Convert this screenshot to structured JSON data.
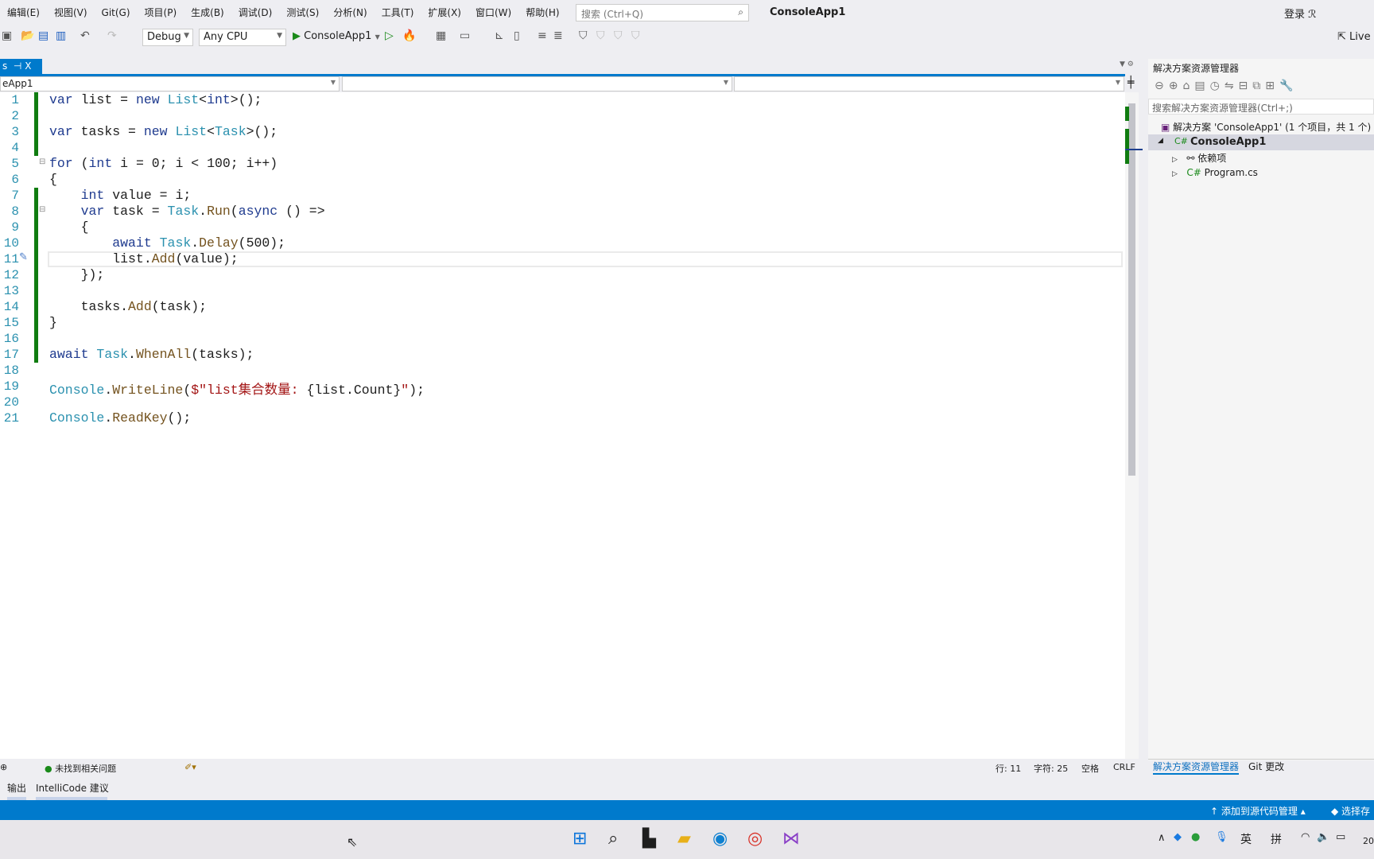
{
  "menu": [
    "编辑(E)",
    "视图(V)",
    "Git(G)",
    "项目(P)",
    "生成(B)",
    "调试(D)",
    "测试(S)",
    "分析(N)",
    "工具(T)",
    "扩展(X)",
    "窗口(W)",
    "帮助(H)"
  ],
  "search_placeholder": "搜索 (Ctrl+Q)",
  "window_title": "ConsoleApp1",
  "login": "登录",
  "toolbar": {
    "config": "Debug",
    "platform": "Any CPU",
    "run_target": "ConsoleApp1",
    "live_share": "Live"
  },
  "tab": {
    "label": "s",
    "pin": "⊣",
    "close": "X"
  },
  "nav": {
    "project": "eApp1"
  },
  "code": {
    "lines": [
      [
        [
          "var",
          "kw"
        ],
        " list = ",
        [
          "new",
          "kw"
        ],
        " ",
        [
          "List",
          "ty"
        ],
        "<",
        [
          "int",
          "kw"
        ],
        ">();"
      ],
      [],
      [
        [
          "var",
          "kw"
        ],
        " tasks = ",
        [
          "new",
          "kw"
        ],
        " ",
        [
          "List",
          "ty"
        ],
        "<",
        [
          "Task",
          "ty"
        ],
        ">();"
      ],
      [],
      [
        [
          "for",
          "kw"
        ],
        " (",
        [
          "int",
          "kw"
        ],
        " i = 0; i < 100; i++)"
      ],
      [
        "{"
      ],
      [
        "    ",
        [
          "int",
          "kw"
        ],
        " value = i;"
      ],
      [
        "    ",
        [
          "var",
          "kw"
        ],
        " task = ",
        [
          "Task",
          "ty"
        ],
        ".",
        [
          "Run",
          "me"
        ],
        "(",
        [
          "async",
          "kw"
        ],
        " () =>"
      ],
      [
        "    {"
      ],
      [
        "        ",
        [
          "await",
          "kw"
        ],
        " ",
        [
          "Task",
          "ty"
        ],
        ".",
        [
          "Delay",
          "me"
        ],
        "(500);"
      ],
      [
        "        list.",
        [
          "Add",
          "me"
        ],
        "(value);"
      ],
      [
        "    });"
      ],
      [],
      [
        "    tasks.",
        [
          "Add",
          "me"
        ],
        "(task);"
      ],
      [
        "}"
      ],
      [],
      [
        [
          "await",
          "kw"
        ],
        " ",
        [
          "Task",
          "ty"
        ],
        ".",
        [
          "WhenAll",
          "me"
        ],
        "(tasks);"
      ],
      [],
      [
        [
          "Console",
          "ty"
        ],
        ".",
        [
          "WriteLine",
          "me"
        ],
        "(",
        [
          "$\"list集合数量: ",
          "st"
        ],
        "{list.Count}",
        [
          "\"",
          "st"
        ],
        ");"
      ],
      [],
      [
        [
          "Console",
          "ty"
        ],
        ".",
        [
          "ReadKey",
          "me"
        ],
        "();"
      ]
    ]
  },
  "solution_explorer": {
    "title": "解决方案资源管理器",
    "search_placeholder": "搜索解决方案资源管理器(Ctrl+;)",
    "solution": "解决方案 'ConsoleApp1' (1 个项目，共 1 个)",
    "project": "ConsoleApp1",
    "deps": "依赖项",
    "file": "Program.cs",
    "tab_active": "解决方案资源管理器",
    "tab_git": "Git 更改"
  },
  "status": {
    "issues": "未找到相关问题",
    "line": "行: 11",
    "char": "字符: 25",
    "spaces": "空格",
    "eol": "CRLF"
  },
  "bottom_tabs": [
    "输出",
    "IntelliCode 建议"
  ],
  "bluebar": {
    "source_control": "添加到源代码管理",
    "select_repo": "选择存"
  },
  "tray": {
    "lang": "英",
    "ime": "拼",
    "clock": "20"
  }
}
